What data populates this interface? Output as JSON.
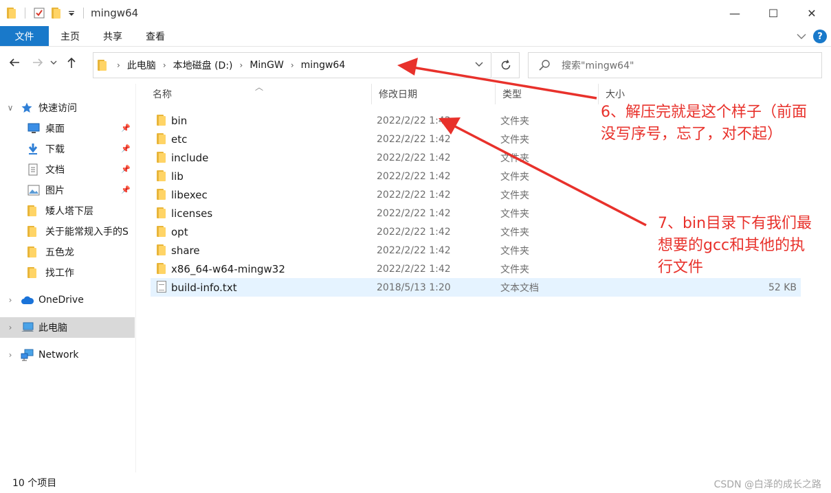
{
  "window": {
    "title": "mingw64",
    "controls": {
      "minimize": "—",
      "maximize": "☐",
      "close": "✕"
    }
  },
  "ribbon": {
    "tabs": [
      "文件",
      "主页",
      "共享",
      "查看"
    ]
  },
  "address": {
    "crumbs": [
      "此电脑",
      "本地磁盘 (D:)",
      "MinGW",
      "mingw64"
    ],
    "search_placeholder": "搜索\"mingw64\""
  },
  "sidebar": {
    "items": [
      {
        "label": "快速访问",
        "icon": "star-icon",
        "expand": "∨",
        "pinned": false
      },
      {
        "label": "桌面",
        "icon": "desktop-icon",
        "pinned": true
      },
      {
        "label": "下载",
        "icon": "download-icon",
        "pinned": true
      },
      {
        "label": "文档",
        "icon": "document-icon",
        "pinned": true
      },
      {
        "label": "图片",
        "icon": "picture-icon",
        "pinned": true
      },
      {
        "label": "矮人塔下层",
        "icon": "folder-icon",
        "pinned": false
      },
      {
        "label": "关于能常规入手的S",
        "icon": "folder-icon",
        "pinned": false
      },
      {
        "label": "五色龙",
        "icon": "folder-icon",
        "pinned": false
      },
      {
        "label": "找工作",
        "icon": "folder-icon",
        "pinned": false
      },
      {
        "label": "OneDrive",
        "icon": "cloud-icon",
        "expand": "›",
        "pinned": false
      },
      {
        "label": "此电脑",
        "icon": "computer-icon",
        "expand": "›",
        "pinned": false
      },
      {
        "label": "Network",
        "icon": "network-icon",
        "expand": "›",
        "pinned": false
      }
    ]
  },
  "columns": {
    "name": "名称",
    "date": "修改日期",
    "type": "类型",
    "size": "大小"
  },
  "files": [
    {
      "name": "bin",
      "date": "2022/2/22 1:42",
      "type": "文件夹",
      "size": "",
      "kind": "folder"
    },
    {
      "name": "etc",
      "date": "2022/2/22 1:42",
      "type": "文件夹",
      "size": "",
      "kind": "folder"
    },
    {
      "name": "include",
      "date": "2022/2/22 1:42",
      "type": "文件夹",
      "size": "",
      "kind": "folder"
    },
    {
      "name": "lib",
      "date": "2022/2/22 1:42",
      "type": "文件夹",
      "size": "",
      "kind": "folder"
    },
    {
      "name": "libexec",
      "date": "2022/2/22 1:42",
      "type": "文件夹",
      "size": "",
      "kind": "folder"
    },
    {
      "name": "licenses",
      "date": "2022/2/22 1:42",
      "type": "文件夹",
      "size": "",
      "kind": "folder"
    },
    {
      "name": "opt",
      "date": "2022/2/22 1:42",
      "type": "文件夹",
      "size": "",
      "kind": "folder"
    },
    {
      "name": "share",
      "date": "2022/2/22 1:42",
      "type": "文件夹",
      "size": "",
      "kind": "folder"
    },
    {
      "name": "x86_64-w64-mingw32",
      "date": "2022/2/22 1:42",
      "type": "文件夹",
      "size": "",
      "kind": "folder"
    },
    {
      "name": "build-info.txt",
      "date": "2018/5/13 1:20",
      "type": "文本文档",
      "size": "52 KB",
      "kind": "text"
    }
  ],
  "status": {
    "count": "10 个项目",
    "watermark": "CSDN @白泽的成长之路"
  },
  "annotations": [
    {
      "lines": [
        "6、解压完就是这个样子（前面",
        "没写序号，忘了，对不起）"
      ]
    },
    {
      "lines": [
        "7、bin目录下有我们最",
        "想要的gcc和其他的执",
        "行文件"
      ]
    }
  ],
  "colors": {
    "accent": "#1979ca",
    "annotation": "#e8312b",
    "selected": "#d9d9d9",
    "hover": "#e5f3ff"
  }
}
